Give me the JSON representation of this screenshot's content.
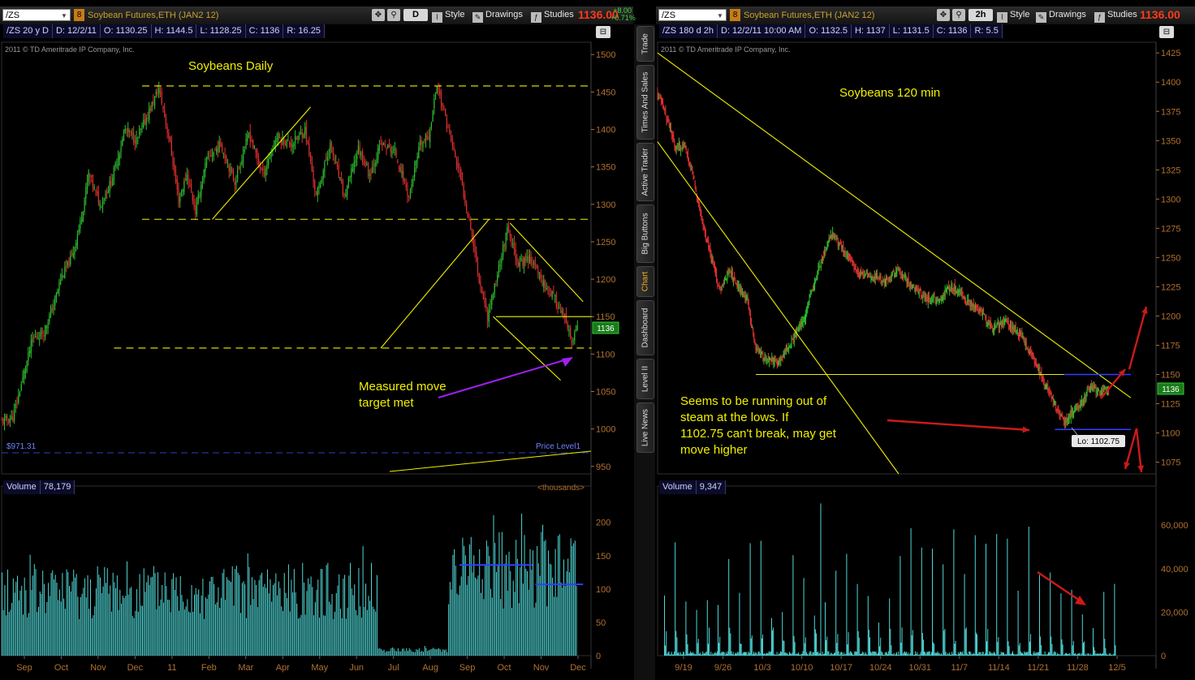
{
  "colors": {
    "up": "#2fbf2f",
    "down": "#e03030",
    "annot": "#f0f000",
    "volume": "#4fd6d6",
    "blue": "#3040ff",
    "axis": "#b07030",
    "price_red": "#ff3a1a"
  },
  "left": {
    "symbol": "/ZS",
    "badge": "8",
    "description": "Soybean Futures,ETH (JAN2 12)",
    "timeframe": "D",
    "style_label": "Style",
    "drawings_label": "Drawings",
    "studies_label": "Studies",
    "last_price": "1136.00",
    "change_abs": "+8.00",
    "change_pct": "+0.71%",
    "info": {
      "symbol": "/ZS 20 y D",
      "date": "D: 12/2/11",
      "open": "O: 1130.25",
      "high": "H: 1144.5",
      "low": "L: 1128.25",
      "close": "C: 1136",
      "range": "R: 16.25"
    },
    "copyright": "2011 © TD Ameritrade IP Company, Inc.",
    "price_tag": "1136",
    "price_level_left": "$971.31",
    "price_level_right": "Price Level1",
    "volume_info": {
      "label": "Volume",
      "value": "78,179"
    },
    "volume_units": "<thousands>"
  },
  "right": {
    "symbol": "/ZS",
    "badge": "8",
    "description": "Soybean Futures,ETH (JAN2 12)",
    "timeframe": "2h",
    "style_label": "Style",
    "drawings_label": "Drawings",
    "studies_label": "Studies",
    "last_price": "1136.00",
    "info": {
      "symbol": "/ZS 180 d 2h",
      "date": "D: 12/2/11 10:00 AM",
      "open": "O: 1132.5",
      "high": "H: 1137",
      "low": "L: 1131.5",
      "close": "C: 1136",
      "range": "R: 5.5"
    },
    "copyright": "2011 © TD Ameritrade IP Company, Inc.",
    "price_tag": "1136",
    "low_label": "Lo: 1102.75",
    "volume_info": {
      "label": "Volume",
      "value": "9,347"
    }
  },
  "sidebar": [
    {
      "label": "Trade",
      "active": false
    },
    {
      "label": "Times And Sales",
      "active": false
    },
    {
      "label": "Active Trader",
      "active": false
    },
    {
      "label": "Big Buttons",
      "active": false
    },
    {
      "label": "Chart",
      "active": true
    },
    {
      "label": "Dashboard",
      "active": false
    },
    {
      "label": "Level II",
      "active": false
    },
    {
      "label": "Live News",
      "active": false
    }
  ],
  "chart_data": [
    {
      "type": "candlestick",
      "title": "Soybeans Daily",
      "annotations": [
        "Measured move",
        "target met"
      ],
      "y_ticks": [
        950,
        1000,
        1050,
        1100,
        1150,
        1200,
        1250,
        1300,
        1350,
        1400,
        1450,
        1500
      ],
      "ylim": [
        940,
        1510
      ],
      "x_ticks": [
        "Sep",
        "Oct",
        "Nov",
        "Dec",
        "11",
        "Feb",
        "Mar",
        "Apr",
        "May",
        "Jun",
        "Jul",
        "Aug",
        "Sep",
        "Oct",
        "Nov",
        "Dec"
      ],
      "close_path": [
        [
          0,
          1010
        ],
        [
          8,
          1015
        ],
        [
          14,
          1060
        ],
        [
          22,
          1120
        ],
        [
          30,
          1130
        ],
        [
          36,
          1160
        ],
        [
          42,
          1200
        ],
        [
          50,
          1230
        ],
        [
          56,
          1275
        ],
        [
          62,
          1340
        ],
        [
          70,
          1300
        ],
        [
          78,
          1330
        ],
        [
          88,
          1400
        ],
        [
          96,
          1385
        ],
        [
          104,
          1420
        ],
        [
          112,
          1455
        ],
        [
          120,
          1380
        ],
        [
          126,
          1305
        ],
        [
          132,
          1340
        ],
        [
          138,
          1290
        ],
        [
          146,
          1360
        ],
        [
          156,
          1380
        ],
        [
          166,
          1330
        ],
        [
          176,
          1395
        ],
        [
          186,
          1340
        ],
        [
          196,
          1390
        ],
        [
          206,
          1380
        ],
        [
          216,
          1400
        ],
        [
          224,
          1310
        ],
        [
          234,
          1380
        ],
        [
          244,
          1310
        ],
        [
          254,
          1375
        ],
        [
          262,
          1340
        ],
        [
          270,
          1380
        ],
        [
          280,
          1370
        ],
        [
          290,
          1310
        ],
        [
          298,
          1380
        ],
        [
          304,
          1390
        ],
        [
          310,
          1460
        ],
        [
          318,
          1400
        ],
        [
          326,
          1340
        ],
        [
          334,
          1270
        ],
        [
          340,
          1200
        ],
        [
          346,
          1150
        ],
        [
          352,
          1200
        ],
        [
          360,
          1265
        ],
        [
          368,
          1220
        ],
        [
          376,
          1230
        ],
        [
          384,
          1200
        ],
        [
          392,
          1180
        ],
        [
          400,
          1150
        ],
        [
          406,
          1115
        ],
        [
          410,
          1136
        ]
      ],
      "lines": [
        {
          "kind": "dashed",
          "from": [
            100,
            1458
          ],
          "to": [
            420,
            1458
          ]
        },
        {
          "kind": "dashed",
          "from": [
            100,
            1280
          ],
          "to": [
            420,
            1280
          ]
        },
        {
          "kind": "dashed",
          "from": [
            80,
            1108
          ],
          "to": [
            420,
            1108
          ]
        },
        {
          "kind": "solid",
          "from": [
            150,
            1280
          ],
          "to": [
            220,
            1430
          ]
        },
        {
          "kind": "solid",
          "from": [
            270,
            1108
          ],
          "to": [
            347,
            1280
          ]
        },
        {
          "kind": "solid",
          "from": [
            350,
            1150
          ],
          "to": [
            398,
            1065
          ]
        },
        {
          "kind": "solid",
          "from": [
            352,
            1150
          ],
          "to": [
            420,
            1150
          ]
        },
        {
          "kind": "solid",
          "from": [
            362,
            1275
          ],
          "to": [
            414,
            1170
          ]
        }
      ],
      "volume": {
        "ylim": [
          0,
          235
        ],
        "y_ticks": [
          0,
          50,
          100,
          150,
          200
        ],
        "segments": [
          {
            "x0": 0,
            "x1": 268,
            "min": 55,
            "max": 165
          },
          {
            "x0": 268,
            "x1": 318,
            "min": 5,
            "max": 15
          },
          {
            "x0": 318,
            "x1": 410,
            "min": 70,
            "max": 225
          }
        ],
        "reference_lines": [
          136,
          107
        ]
      }
    },
    {
      "type": "candlestick",
      "title": "Soybeans 120 min",
      "annotations": [
        "Seems to be running out of",
        "steam at the lows.  If",
        "1102.75 can't break, may get",
        "move higher"
      ],
      "y_ticks": [
        1075,
        1100,
        1125,
        1150,
        1175,
        1200,
        1225,
        1250,
        1275,
        1300,
        1325,
        1350,
        1375,
        1400,
        1425
      ],
      "ylim": [
        1065,
        1430
      ],
      "x_ticks": [
        "9/19",
        "9/26",
        "10/3",
        "10/10",
        "10/17",
        "10/24",
        "10/31",
        "11/7",
        "11/14",
        "11/21",
        "11/28",
        "12/5"
      ],
      "close_path": [
        [
          0,
          1390
        ],
        [
          10,
          1370
        ],
        [
          20,
          1345
        ],
        [
          30,
          1345
        ],
        [
          40,
          1320
        ],
        [
          50,
          1280
        ],
        [
          60,
          1250
        ],
        [
          70,
          1220
        ],
        [
          80,
          1240
        ],
        [
          90,
          1225
        ],
        [
          100,
          1215
        ],
        [
          110,
          1172
        ],
        [
          120,
          1165
        ],
        [
          135,
          1160
        ],
        [
          150,
          1178
        ],
        [
          165,
          1200
        ],
        [
          180,
          1240
        ],
        [
          195,
          1270
        ],
        [
          210,
          1255
        ],
        [
          225,
          1235
        ],
        [
          240,
          1235
        ],
        [
          255,
          1230
        ],
        [
          270,
          1240
        ],
        [
          285,
          1225
        ],
        [
          300,
          1215
        ],
        [
          315,
          1215
        ],
        [
          330,
          1225
        ],
        [
          345,
          1215
        ],
        [
          360,
          1205
        ],
        [
          375,
          1190
        ],
        [
          390,
          1195
        ],
        [
          405,
          1185
        ],
        [
          420,
          1165
        ],
        [
          435,
          1140
        ],
        [
          445,
          1125
        ],
        [
          455,
          1108
        ],
        [
          465,
          1120
        ],
        [
          475,
          1125
        ],
        [
          485,
          1140
        ],
        [
          495,
          1135
        ],
        [
          505,
          1136
        ]
      ],
      "lines": [
        {
          "kind": "solid",
          "color": "annot",
          "from": [
            0,
            1425
          ],
          "to": [
            530,
            1130
          ]
        },
        {
          "kind": "solid",
          "color": "annot",
          "from": [
            0,
            1349
          ],
          "to": [
            270,
            1065
          ]
        },
        {
          "kind": "solid",
          "color": "annot",
          "from": [
            110,
            1150
          ],
          "to": [
            470,
            1150
          ]
        },
        {
          "kind": "solid",
          "color": "blue",
          "from": [
            445,
            1103
          ],
          "to": [
            530,
            1103
          ]
        },
        {
          "kind": "solid",
          "color": "blue",
          "from": [
            455,
            1150
          ],
          "to": [
            530,
            1150
          ]
        }
      ],
      "volume": {
        "ylim": [
          0,
          72000
        ],
        "y_ticks": [
          0,
          20000,
          40000,
          60000
        ]
      }
    }
  ]
}
